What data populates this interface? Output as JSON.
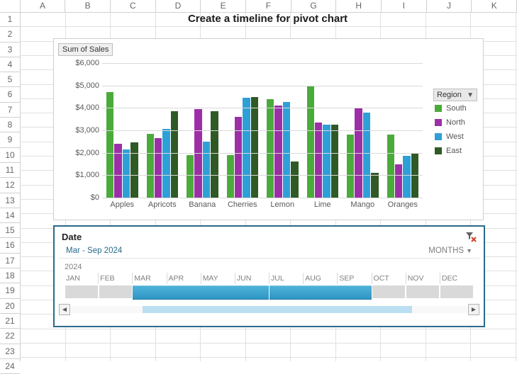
{
  "title": "Create a timeline for pivot chart",
  "columns": [
    "A",
    "B",
    "C",
    "D",
    "E",
    "F",
    "G",
    "H",
    "I",
    "J",
    "K"
  ],
  "row_count": 24,
  "chart_box": {
    "metric_label": "Sum of Sales",
    "legend_title": "Region"
  },
  "chart_data": {
    "type": "bar",
    "title": "",
    "xlabel": "",
    "ylabel": "",
    "ylim": [
      0,
      6000
    ],
    "ytick_format": "$#,##0",
    "yticks": [
      0,
      1000,
      2000,
      3000,
      4000,
      5000,
      6000
    ],
    "categories": [
      "Apples",
      "Apricots",
      "Banana",
      "Cherries",
      "Lemon",
      "Lime",
      "Mango",
      "Oranges"
    ],
    "series": [
      {
        "name": "South",
        "color": "#4aab3a",
        "values": [
          4700,
          2850,
          1900,
          1900,
          4400,
          5000,
          2800,
          2800
        ]
      },
      {
        "name": "North",
        "color": "#9c2fa6",
        "values": [
          2400,
          2650,
          3950,
          3600,
          4100,
          3350,
          4000,
          1500
        ]
      },
      {
        "name": "West",
        "color": "#2ea0d8",
        "values": [
          2150,
          3050,
          2500,
          4450,
          4250,
          3250,
          3800,
          1850
        ]
      },
      {
        "name": "East",
        "color": "#2f5a25",
        "values": [
          2450,
          3850,
          3850,
          4500,
          1600,
          3250,
          1100,
          2000
        ]
      }
    ]
  },
  "timeline": {
    "title": "Date",
    "range_label": "Mar - Sep 2024",
    "units_label": "MONTHS",
    "year": "2024",
    "months": [
      "JAN",
      "FEB",
      "MAR",
      "APR",
      "MAY",
      "JUN",
      "JUL",
      "AUG",
      "SEP",
      "OCT",
      "NOV",
      "DEC"
    ],
    "selected_start_idx": 2,
    "selected_end_idx": 8,
    "scroll_thumb": {
      "left_pct": 18,
      "width_pct": 68
    }
  }
}
